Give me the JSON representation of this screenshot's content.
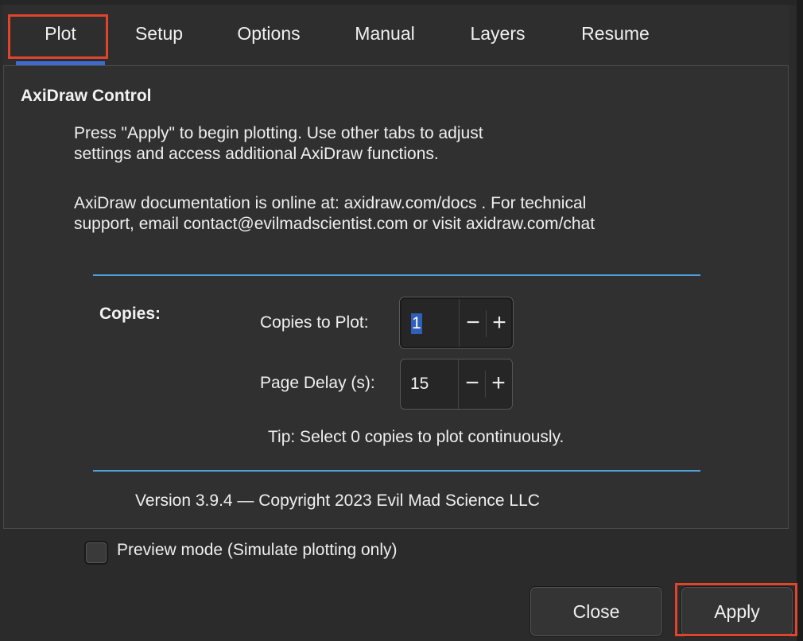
{
  "tabs": [
    {
      "label": "Plot",
      "active": true
    },
    {
      "label": "Setup"
    },
    {
      "label": "Options"
    },
    {
      "label": "Manual"
    },
    {
      "label": "Layers"
    },
    {
      "label": "Resume"
    }
  ],
  "panel": {
    "title": "AxiDraw Control",
    "intro_line1": "Press \"Apply\" to begin plotting. Use other tabs to adjust",
    "intro_line2": "settings and access additional AxiDraw functions.",
    "docs_line1": "AxiDraw documentation is online at: axidraw.com/docs . For technical",
    "docs_line2": "support, email  contact@evilmadscientist.com  or visit axidraw.com/chat",
    "copies_section": "Copies:",
    "copies_to_plot": {
      "label": "Copies to Plot:",
      "value": "1"
    },
    "page_delay": {
      "label": "Page Delay (s):",
      "value": "15"
    },
    "tip": "Tip: Select 0 copies to plot continuously.",
    "version": "Version 3.9.4 — Copyright 2023 Evil Mad Science LLC"
  },
  "spin_symbols": {
    "minus": "−",
    "plus": "+"
  },
  "preview": {
    "label": "Preview mode (Simulate plotting only)",
    "checked": false
  },
  "buttons": {
    "close": "Close",
    "apply": "Apply"
  },
  "colors": {
    "accent": "#3d6bd0",
    "divider": "#4f9fd8",
    "highlight": "#e0452c",
    "background": "#2b2b2b"
  }
}
